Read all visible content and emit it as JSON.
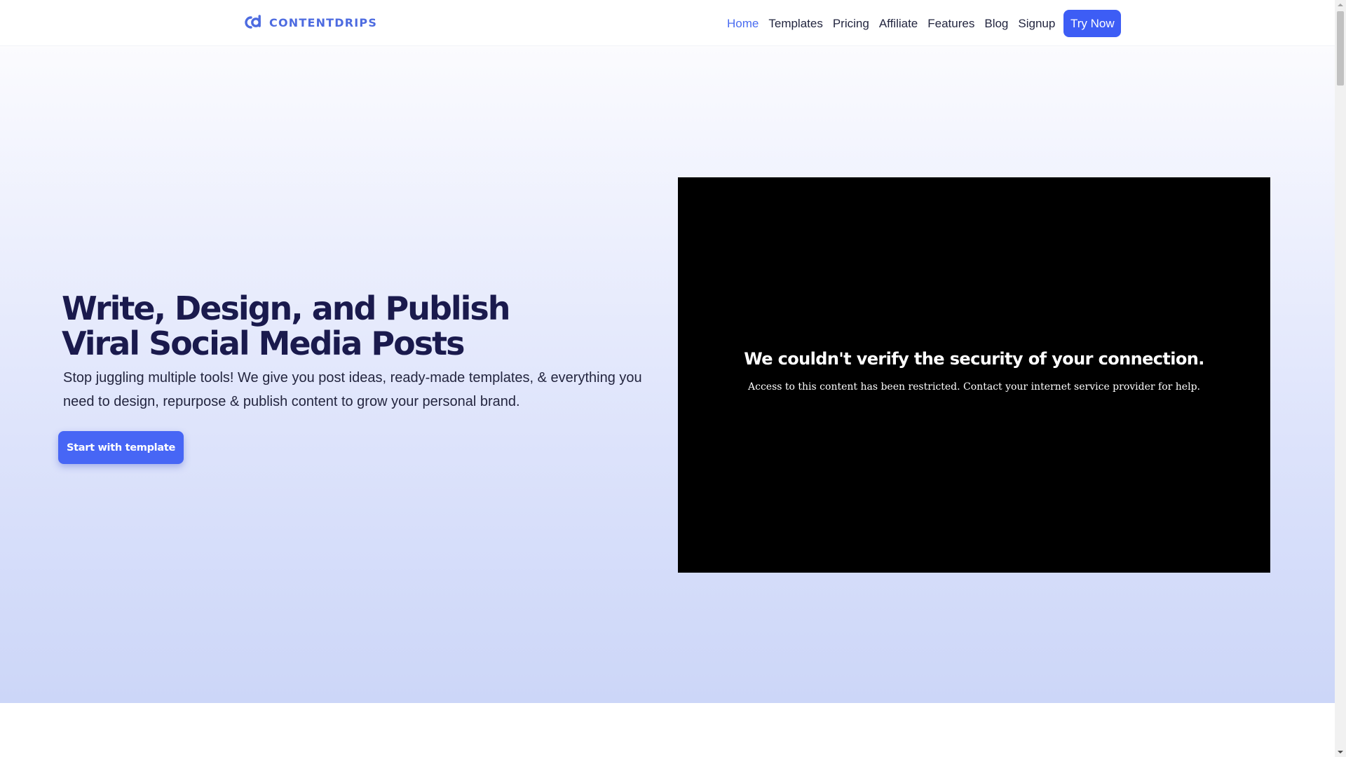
{
  "header": {
    "logo_text": "CONTENTDRIPS",
    "nav": [
      {
        "label": "Home",
        "active": true
      },
      {
        "label": "Templates",
        "active": false
      },
      {
        "label": "Pricing",
        "active": false
      },
      {
        "label": "Affiliate",
        "active": false
      },
      {
        "label": "Features",
        "active": false
      },
      {
        "label": "Blog",
        "active": false
      },
      {
        "label": "Signup",
        "active": false
      }
    ],
    "cta_label": "Try Now"
  },
  "hero": {
    "title": "Write, Design, and Publish Viral Social Media Posts",
    "subtitle": "Stop juggling multiple tools! We give you post ideas, ready-made templates, & everything you need to design, repurpose & publish content to grow your personal brand.",
    "cta_label": "Start with template"
  },
  "video": {
    "heading": "We couldn't verify the security of your connection.",
    "message": "Access to this content has been restricted. Contact your internet service provider for help."
  },
  "colors": {
    "brand": "#4d6be0",
    "primary_button": "#3d5df5",
    "heading": "#1a1a4d",
    "active_nav": "#4a6cf0"
  }
}
